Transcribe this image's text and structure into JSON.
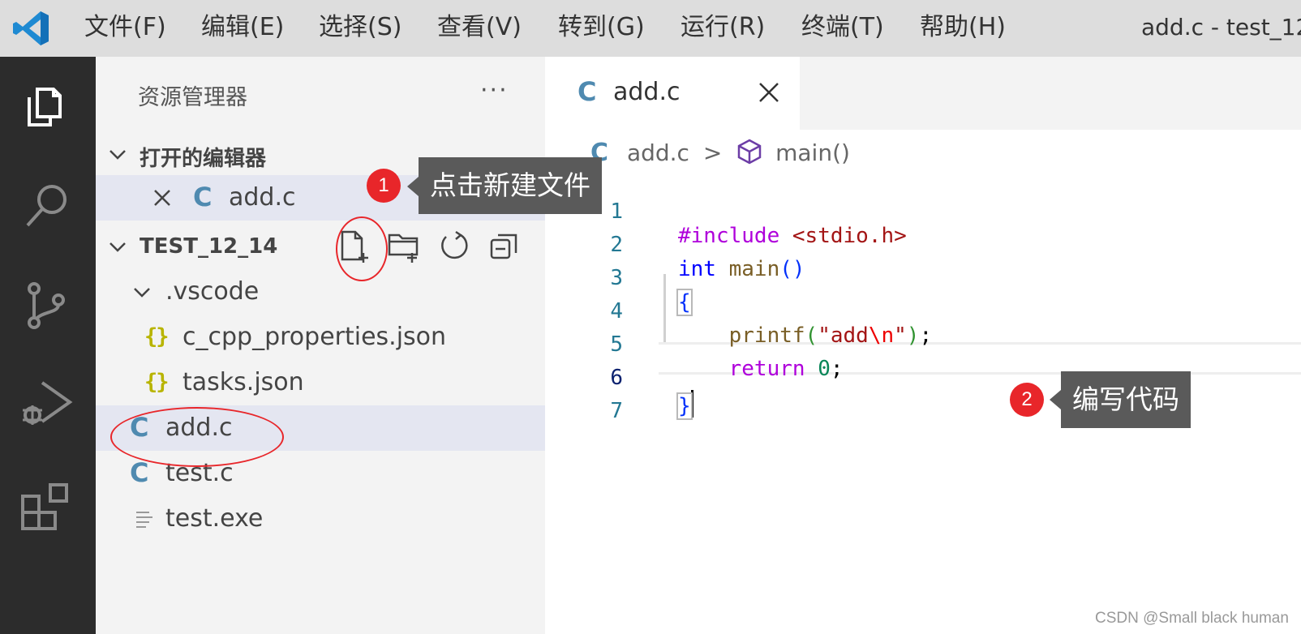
{
  "menu": {
    "items": [
      "文件(F)",
      "编辑(E)",
      "选择(S)",
      "查看(V)",
      "转到(G)",
      "运行(R)",
      "终端(T)",
      "帮助(H)"
    ],
    "window_title": "add.c - test_12"
  },
  "sidebar": {
    "title": "资源管理器",
    "more": "···",
    "open_editors": {
      "header": "打开的编辑器",
      "items": [
        {
          "icon": "C",
          "name": "add.c"
        }
      ]
    },
    "folder": {
      "header": "TEST_12_14",
      "subfolder": ".vscode",
      "files": [
        {
          "icon": "{}",
          "name": "c_cpp_properties.json"
        },
        {
          "icon": "{}",
          "name": "tasks.json"
        },
        {
          "icon": "C",
          "name": "add.c"
        },
        {
          "icon": "C",
          "name": "test.c"
        },
        {
          "icon": "lines-icon",
          "name": "test.exe"
        }
      ]
    }
  },
  "editor": {
    "tab": {
      "icon": "C",
      "label": "add.c"
    },
    "breadcrumb": {
      "file": "add.c",
      "separator": ">",
      "symbol": "main()"
    },
    "line_numbers": [
      "1",
      "2",
      "3",
      "4",
      "5",
      "6",
      "7"
    ],
    "code": {
      "l1a": "#include ",
      "l1b": "<stdio.h>",
      "l2a": "int",
      "l2b": "main",
      "l2c": "()",
      "l3": "{",
      "l4a": "printf",
      "l4b": "(",
      "l4c": "\"add",
      "l4d": "\\n",
      "l4e": "\"",
      "l4f": ")",
      "l4g": ";",
      "l5a": "return",
      "l5b": "0",
      "l5c": ";",
      "l6": "}"
    }
  },
  "annotations": {
    "callout1": {
      "badge": "1",
      "text": "点击新建文件"
    },
    "callout2": {
      "badge": "2",
      "text": "编写代码"
    }
  },
  "watermark": "CSDN @Small black human",
  "colors": {
    "activity_bar": "#2c2c2c",
    "accent_red": "#e8262a",
    "c_icon": "#4f8ab0",
    "json_icon": "#b8b400"
  }
}
